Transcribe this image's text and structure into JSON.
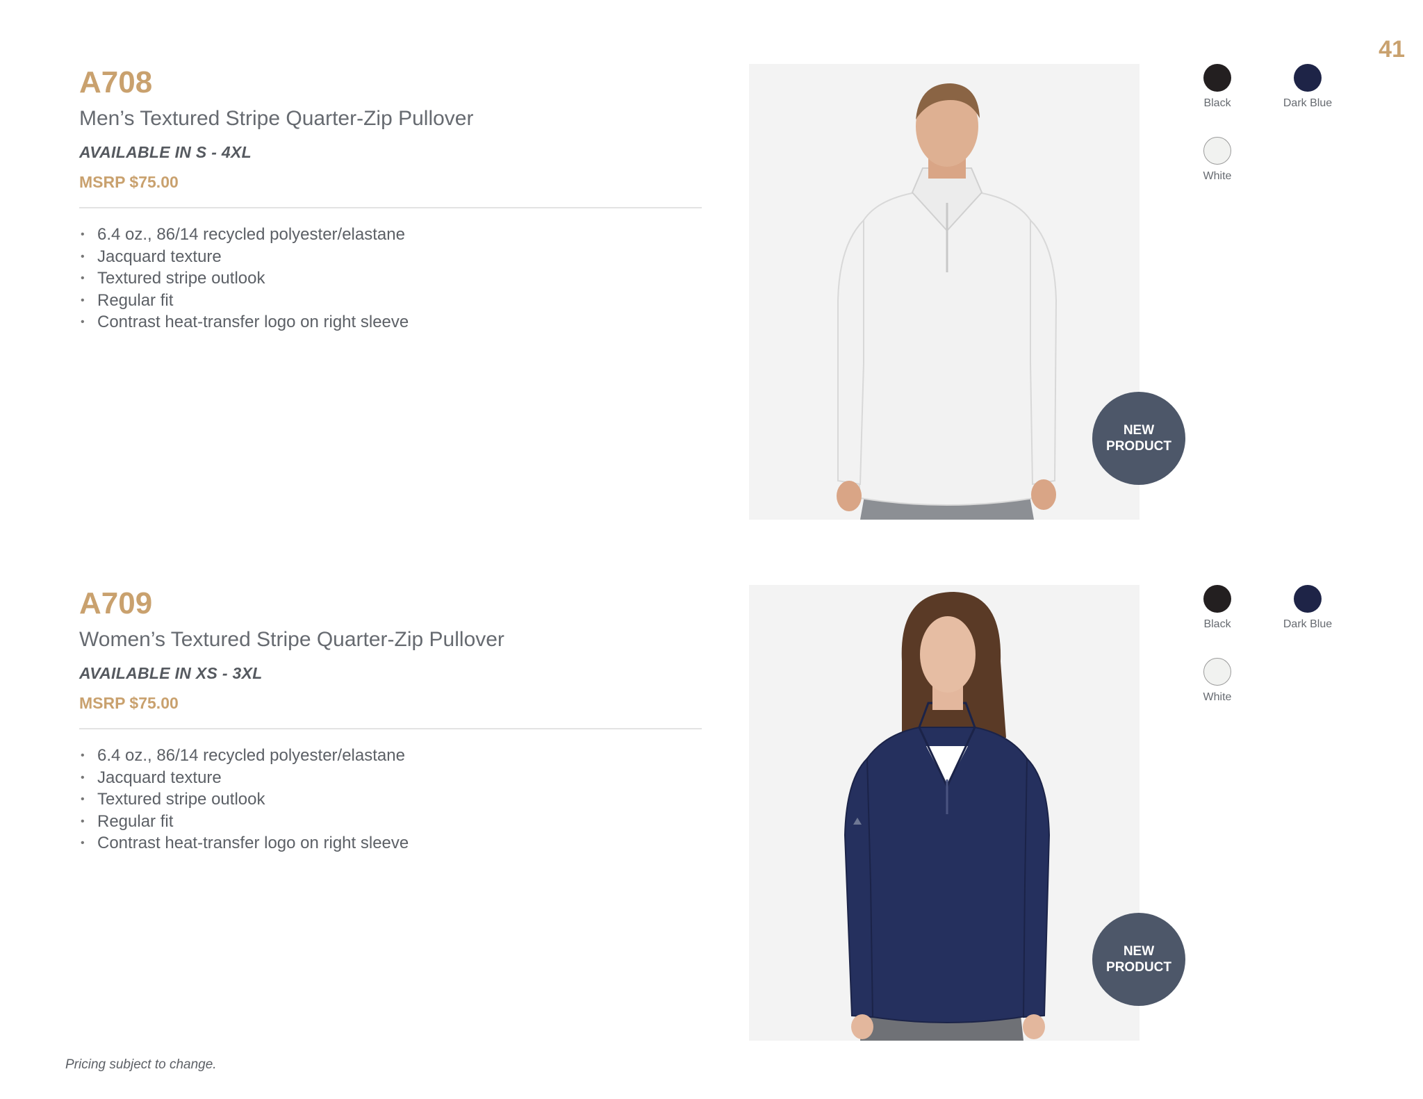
{
  "page": {
    "number": "41",
    "footer_note": "Pricing subject to change."
  },
  "products": [
    {
      "code": "A708",
      "name": "Men’s Textured Stripe Quarter-Zip Pullover",
      "sizes": "AVAILABLE IN S - 4XL",
      "price": "MSRP $75.00",
      "features": [
        "6.4 oz., 86/14 recycled polyester/elastane",
        "Jacquard texture",
        "Textured stripe outlook",
        "Regular fit",
        "Contrast heat-transfer logo on right sleeve"
      ],
      "badge": {
        "line1": "NEW",
        "line2": "PRODUCT"
      },
      "colors": [
        {
          "label": "Black",
          "hex": "#231f20"
        },
        {
          "label": "Dark Blue",
          "hex": "#1e2447"
        },
        {
          "label": "White",
          "hex": "#f1f2f0"
        }
      ],
      "garment_color": "#f2f2f2"
    },
    {
      "code": "A709",
      "name": "Women’s Textured Stripe Quarter-Zip Pullover",
      "sizes": "AVAILABLE IN XS - 3XL",
      "price": "MSRP $75.00",
      "features": [
        "6.4 oz., 86/14 recycled polyester/elastane",
        "Jacquard texture",
        "Textured stripe outlook",
        "Regular fit",
        "Contrast heat-transfer logo on right sleeve"
      ],
      "badge": {
        "line1": "NEW",
        "line2": "PRODUCT"
      },
      "colors": [
        {
          "label": "Black",
          "hex": "#231f20"
        },
        {
          "label": "Dark Blue",
          "hex": "#1e2447"
        },
        {
          "label": "White",
          "hex": "#f1f2f0"
        }
      ],
      "garment_color": "#25305e"
    }
  ]
}
